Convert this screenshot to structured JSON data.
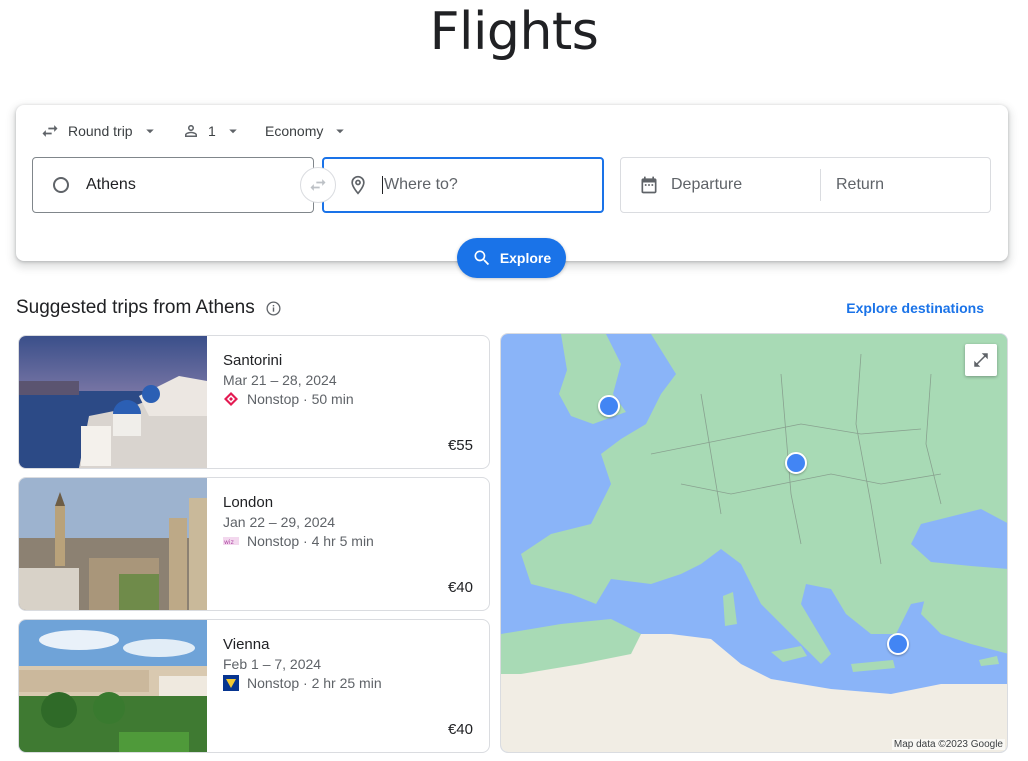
{
  "page": {
    "title": "Flights"
  },
  "search": {
    "trip_type": "Round trip",
    "passengers": "1",
    "cabin_class": "Economy",
    "from_value": "Athens",
    "to_placeholder": "Where to?",
    "departure_placeholder": "Departure",
    "return_placeholder": "Return",
    "explore_label": "Explore"
  },
  "suggestions": {
    "title": "Suggested trips from Athens",
    "explore_link": "Explore destinations",
    "trips": [
      {
        "city": "Santorini",
        "dates": "Mar 21 – 28, 2024",
        "flight": "Nonstop · 50 min",
        "price": "€55"
      },
      {
        "city": "London",
        "dates": "Jan 22 – 29, 2024",
        "flight": "Nonstop · 4 hr 5 min",
        "price": "€40"
      },
      {
        "city": "Vienna",
        "dates": "Feb 1 – 7, 2024",
        "flight": "Nonstop · 2 hr 25 min",
        "price": "€40"
      }
    ]
  },
  "map": {
    "credit": "Map data ©2023 Google"
  },
  "colors": {
    "accent": "#1a73e8",
    "map_water": "#8ab4f8",
    "map_land": "#a8dab5",
    "pin": "#4285f4"
  },
  "icons": [
    "swap-icon",
    "chevron-down-icon",
    "person-icon",
    "location-pin-icon",
    "calendar-icon",
    "search-icon",
    "info-icon",
    "expand-icon"
  ]
}
